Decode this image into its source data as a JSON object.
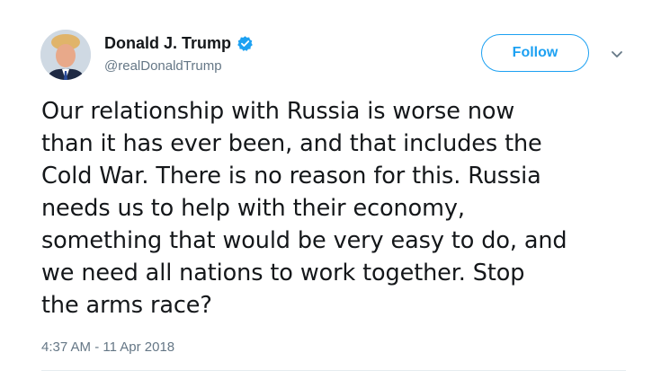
{
  "tweet": {
    "author": {
      "display_name": "Donald J. Trump",
      "handle": "@realDonaldTrump",
      "verified_icon": "verified-badge-icon",
      "avatar_icon": "profile-avatar"
    },
    "follow_label": "Follow",
    "more_icon": "chevron-down-icon",
    "text": "Our relationship with Russia is worse now\nthan it has ever been, and that includes the\nCold War. There is no reason for this. Russia\nneeds us to help with their economy,\nsomething that would be very easy to do, and\nwe need all nations to work together. Stop\nthe arms race?",
    "timestamp": "4:37 AM - 11 Apr 2018"
  },
  "colors": {
    "accent": "#1da1f2",
    "text_primary": "#14171a",
    "text_secondary": "#657786",
    "divider": "#e6ecf0"
  }
}
